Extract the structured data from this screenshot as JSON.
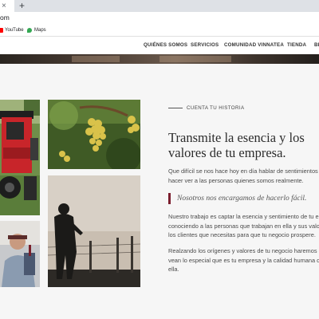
{
  "browser": {
    "tab_close": "×",
    "new_tab": "+",
    "url_fragment": "om",
    "bookmarks": [
      {
        "label": "YouTube",
        "icon": "youtube-icon",
        "color": "#ff0000"
      },
      {
        "label": "Maps",
        "icon": "maps-icon",
        "color": "#34a853"
      }
    ]
  },
  "nav": {
    "items": [
      "QUIÉNES SOMOS",
      "SERVICIOS",
      "COMUNIDAD VINNATEA",
      "TIENDA",
      "BL"
    ]
  },
  "section": {
    "label": "CUENTA TU HISTORIA",
    "headline_line1": "Transmite la esencia y los",
    "headline_line2": "valores de tu empresa.",
    "para1_line1": "Que difícil se nos hace hoy en día hablar de sentimientos y",
    "para1_line2": "hacer  ver a las personas quienes somos realmente.",
    "quote": "Nosotros nos encargamos de hacerlo fácil.",
    "para2_line1": "Nuestro trabajo es captar la esencia y sentimiento de tu e",
    "para2_line2": "conociendo a las personas que trabajan en ella y sus valor",
    "para2_line3": "los clientes que necesitas para que tu negocio prospere.",
    "para3_line1": "Realzando los orígenes y valores de tu negocio haremos c",
    "para3_line2": "vean lo especial que es tu empresa y la calidad humana qu",
    "para3_line3": "ella."
  },
  "colors": {
    "accent": "#7b1e2e",
    "heading": "#2c2c2c",
    "body_text": "#4a4a4a",
    "page_bg": "#f6f6f6"
  }
}
